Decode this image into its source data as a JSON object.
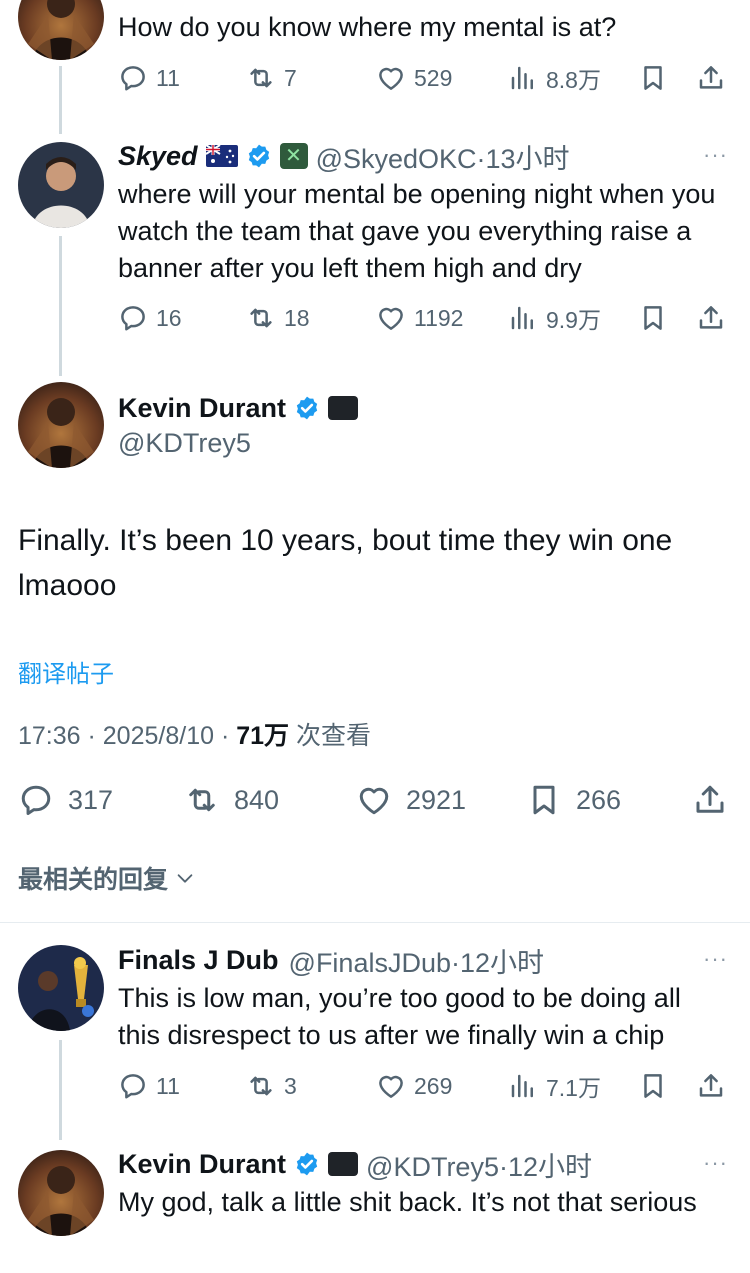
{
  "tweet1": {
    "text": "How do you know where my mental is at?",
    "replies": "11",
    "retweets": "7",
    "likes": "529",
    "views": "8.8万"
  },
  "tweet2": {
    "name": "Skyed",
    "handle_time": "@SkyedOKC·13小时",
    "text": "where will your mental be opening night when you watch the team that gave you everything raise a banner after you left them high and dry",
    "replies": "16",
    "retweets": "18",
    "likes": "1192",
    "views": "9.9万",
    "more": "···"
  },
  "main_tweet": {
    "name": "Kevin Durant",
    "handle": "@KDTrey5",
    "text": "Finally. It’s been 10 years, bout time they win one lmaooo",
    "translate": "翻译帖子",
    "time": "17:36 · 2025/8/10 · ",
    "views_count": "71万",
    "views_label": " 次查看",
    "replies": "317",
    "retweets": "840",
    "likes": "2921",
    "bookmarks": "266"
  },
  "replies_filter": "最相关的回复",
  "reply1": {
    "name": "Finals J Dub",
    "handle_time": "@FinalsJDub·12小时",
    "text": "This is low man, you’re too good to be doing all this disrespect to us after we finally win a chip",
    "replies": "11",
    "retweets": "3",
    "likes": "269",
    "views": "7.1万",
    "more": "···"
  },
  "reply2": {
    "name": "Kevin Durant",
    "handle_time": "@KDTrey5·12小时",
    "text": "My god, talk a little shit back. It’s not that serious",
    "more": "···"
  },
  "colors": {
    "verified_blue": "#1d9bf0",
    "link_blue": "#1d9bf0",
    "secondary": "#536471",
    "thread_line": "#cfd9de"
  },
  "icons": [
    "reply-icon",
    "retweet-icon",
    "like-icon",
    "views-icon",
    "bookmark-icon",
    "share-icon",
    "verified-icon",
    "chevron-down-icon",
    "more-icon"
  ]
}
